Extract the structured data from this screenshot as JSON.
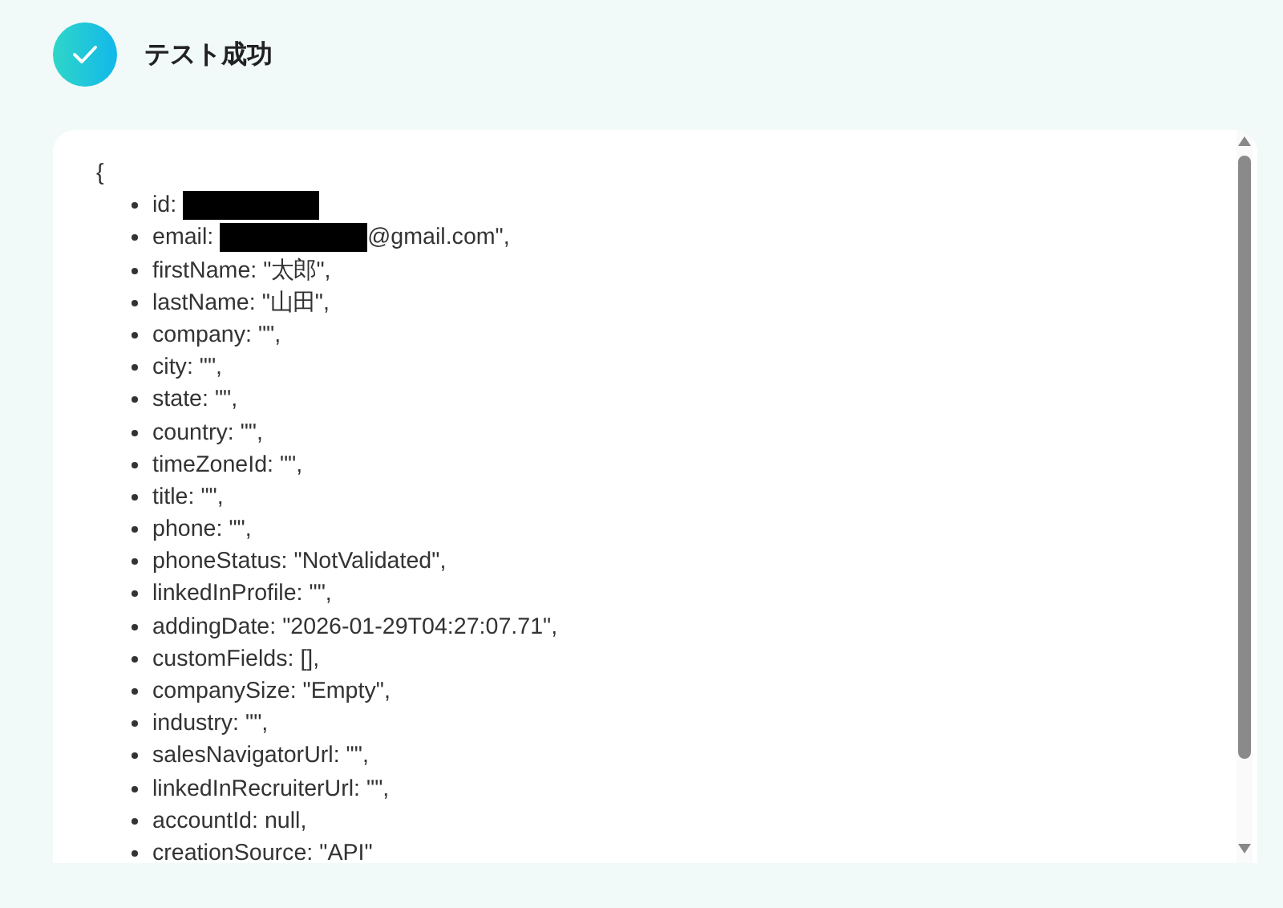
{
  "header": {
    "title": "テスト成功"
  },
  "result": {
    "open_brace": "{",
    "items": [
      {
        "key": "id:",
        "redacted": true
      },
      {
        "key": "email:",
        "redacted": true,
        "value": "@gmail.com\","
      },
      {
        "key": "firstName:",
        "redacted": false,
        "value": "\"太郎\","
      },
      {
        "key": "lastName:",
        "redacted": false,
        "value": "\"山田\","
      },
      {
        "key": "company:",
        "redacted": false,
        "value": "\"\","
      },
      {
        "key": "city:",
        "redacted": false,
        "value": "\"\","
      },
      {
        "key": "state:",
        "redacted": false,
        "value": "\"\","
      },
      {
        "key": "country:",
        "redacted": false,
        "value": "\"\","
      },
      {
        "key": "timeZoneId:",
        "redacted": false,
        "value": "\"\","
      },
      {
        "key": "title:",
        "redacted": false,
        "value": "\"\","
      },
      {
        "key": "phone:",
        "redacted": false,
        "value": "\"\","
      },
      {
        "key": "phoneStatus:",
        "redacted": false,
        "value": "\"NotValidated\","
      },
      {
        "key": "linkedInProfile:",
        "redacted": false,
        "value": "\"\","
      },
      {
        "key": "addingDate:",
        "redacted": false,
        "value": "\"2026-01-29T04:27:07.71\","
      },
      {
        "key": "customFields:",
        "redacted": false,
        "value": "[],"
      },
      {
        "key": "companySize:",
        "redacted": false,
        "value": "\"Empty\","
      },
      {
        "key": "industry:",
        "redacted": false,
        "value": "\"\","
      },
      {
        "key": "salesNavigatorUrl:",
        "redacted": false,
        "value": "\"\","
      },
      {
        "key": "linkedInRecruiterUrl:",
        "redacted": false,
        "value": "\"\","
      },
      {
        "key": "accountId:",
        "redacted": false,
        "value": "null,"
      },
      {
        "key": "creationSource:",
        "redacted": false,
        "value": "\"API\""
      }
    ]
  }
}
